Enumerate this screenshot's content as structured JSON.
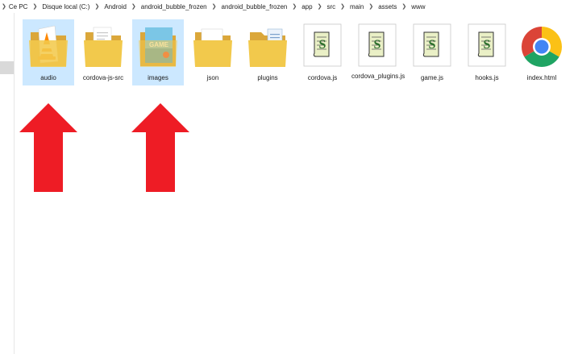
{
  "breadcrumb": [
    "Ce PC",
    "Disque local (C:)",
    "Android",
    "android_bubble_frozen",
    "android_bubble_frozen",
    "app",
    "src",
    "main",
    "assets",
    "www"
  ],
  "files": [
    {
      "label": "audio",
      "kind": "folder-vlc",
      "selected": true
    },
    {
      "label": "cordova-js-src",
      "kind": "folder-docs",
      "selected": false
    },
    {
      "label": "images",
      "kind": "folder-image",
      "selected": true
    },
    {
      "label": "json",
      "kind": "folder-plain",
      "selected": false
    },
    {
      "label": "plugins",
      "kind": "folder-docs-blue",
      "selected": false
    },
    {
      "label": "cordova.js",
      "kind": "script-file",
      "selected": false
    },
    {
      "label": "cordova_plugins.js",
      "kind": "script-file",
      "selected": false
    },
    {
      "label": "game.js",
      "kind": "script-file",
      "selected": false
    },
    {
      "label": "hooks.js",
      "kind": "script-file",
      "selected": false
    },
    {
      "label": "index.html",
      "kind": "chrome-html",
      "selected": false
    }
  ],
  "annotations": {
    "arrow_color": "#ee1c25",
    "targets": [
      "audio",
      "images"
    ]
  },
  "colors": {
    "selection": "#cce8ff",
    "folder": "#f2c94c",
    "folder_dark": "#dba73a"
  }
}
